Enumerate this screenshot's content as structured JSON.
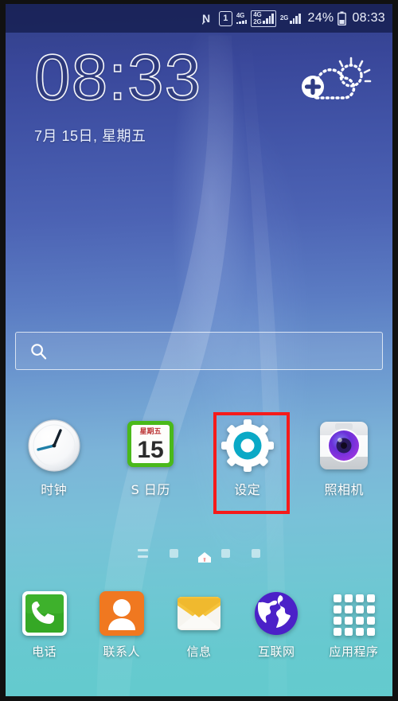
{
  "statusbar": {
    "nfc_icon": "nfc-n-icon",
    "sim_badge": "1",
    "sim1_network": "4G",
    "sim2_network_top": "4G",
    "sim2_network_bottom": "2G",
    "sim3_network": "2G",
    "battery_percent": "24%",
    "battery_icon": "battery-icon",
    "clock": "08:33",
    "background_color": "#1a2250"
  },
  "clock_widget": {
    "time": "08:33",
    "date": "7月 15日, 星期五",
    "weather_add_icon": "add-weather-icon"
  },
  "search": {
    "placeholder": "",
    "value": "",
    "icon": "search-icon"
  },
  "apps": [
    {
      "label": "时钟",
      "icon": "clock-app-icon",
      "highlighted": false
    },
    {
      "label": "S 日历",
      "icon": "calendar-app-icon",
      "highlighted": false,
      "calendar_weekday": "星期五",
      "calendar_day": "15"
    },
    {
      "label": "设定",
      "icon": "settings-gear-icon",
      "highlighted": true
    },
    {
      "label": "照相机",
      "icon": "camera-app-icon",
      "highlighted": false
    }
  ],
  "page_indicators": {
    "items": [
      "list-page-icon",
      "page-dot",
      "home-page-icon",
      "page-dot",
      "page-dot"
    ],
    "active_index": 2
  },
  "dock": [
    {
      "label": "电话",
      "icon": "phone-app-icon"
    },
    {
      "label": "联系人",
      "icon": "contacts-app-icon"
    },
    {
      "label": "信息",
      "icon": "messages-app-icon"
    },
    {
      "label": "互联网",
      "icon": "internet-browser-icon"
    },
    {
      "label": "应用程序",
      "icon": "apps-grid-icon"
    }
  ],
  "colors": {
    "highlight_red": "#f51b1b",
    "wallpaper_top": "#313f86",
    "wallpaper_bottom": "#63cbce",
    "settings_teal": "#0aa9c6",
    "phone_green": "#35a825",
    "contacts_orange": "#f07820",
    "messages_yellow": "#f5c33c",
    "internet_purple": "#4b21c8",
    "calendar_green": "#4ab91a"
  }
}
